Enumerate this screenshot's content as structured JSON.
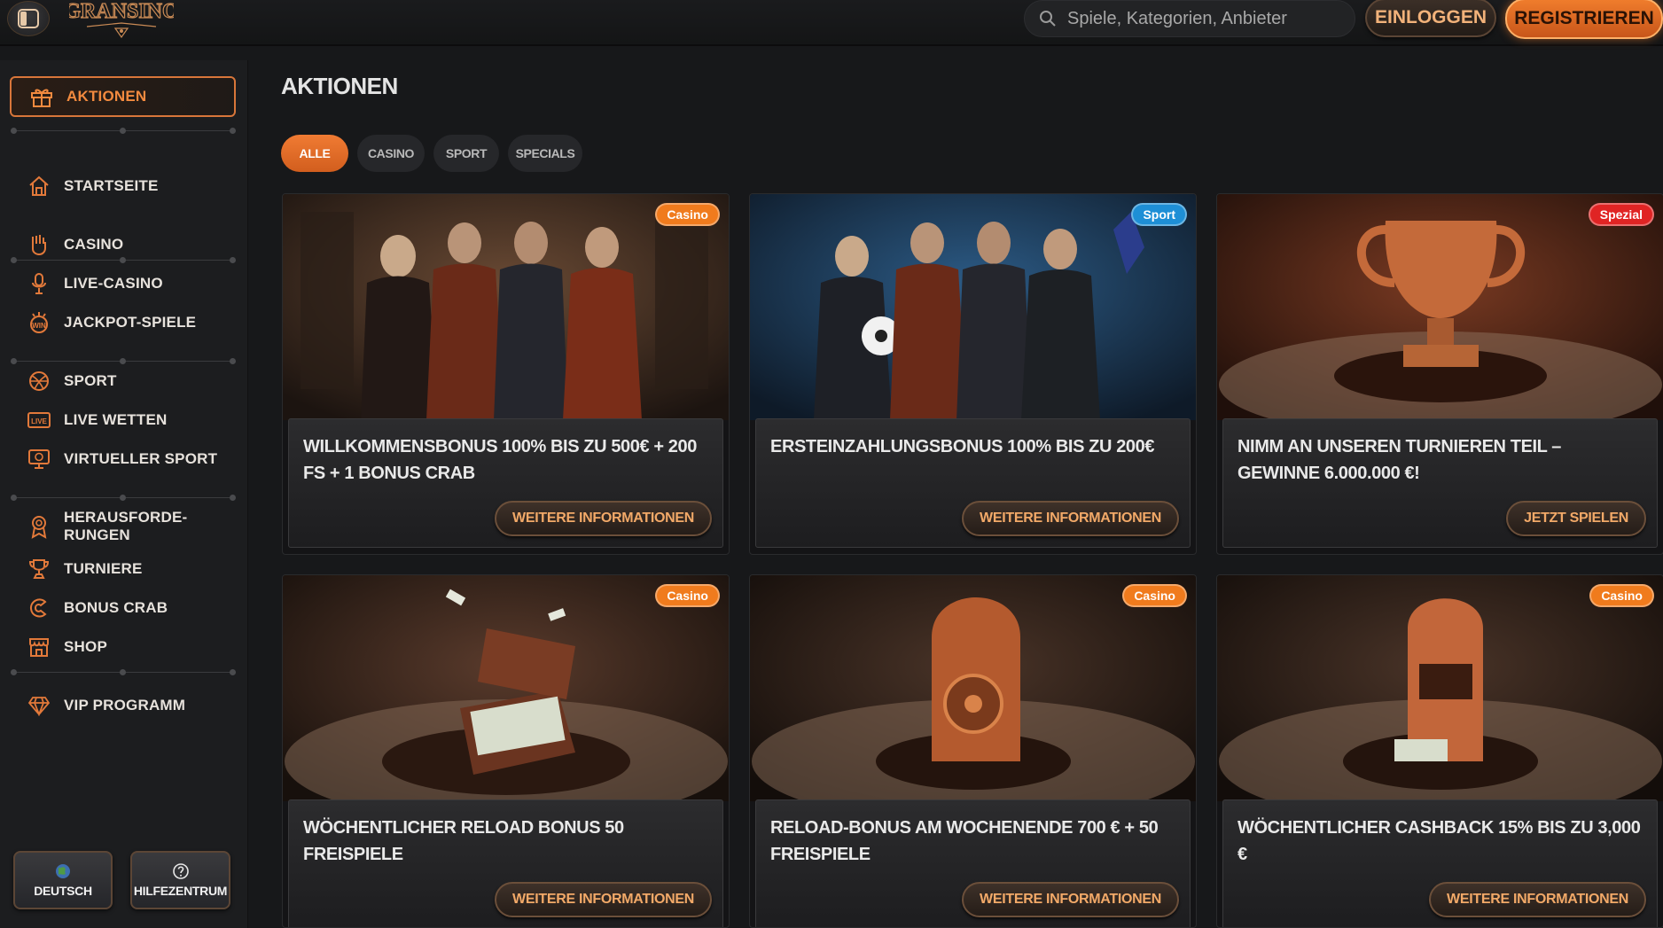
{
  "header": {
    "logo_text": "GRANSINO",
    "search_placeholder": "Spiele, Kategorien, Anbieter",
    "login_label": "EINLOGGEN",
    "register_label": "REGISTRIEREN"
  },
  "sidebar": {
    "active_label": "AKTIONEN",
    "items": [
      {
        "label": "STARTSEITE",
        "icon": "home-icon"
      },
      {
        "label": "CASINO",
        "icon": "casino-hand-icon"
      },
      {
        "label": "LIVE-CASINO",
        "icon": "microphone-icon"
      },
      {
        "label": "JACKPOT-SPIELE",
        "icon": "jackpot-win-icon"
      },
      {
        "label": "SPORT",
        "icon": "ball-icon"
      },
      {
        "label": "LIVE WETTEN",
        "icon": "live-icon"
      },
      {
        "label": "VIRTUELLER SPORT",
        "icon": "virtual-screen-icon"
      },
      {
        "label": "HERAUSFORDE-",
        "label2": "RUNGEN",
        "icon": "medal-icon"
      },
      {
        "label": "TURNIERE",
        "icon": "trophy-icon"
      },
      {
        "label": "BONUS CRAB",
        "icon": "crab-claw-icon"
      },
      {
        "label": "SHOP",
        "icon": "shop-icon"
      },
      {
        "label": "VIP PROGRAMM",
        "icon": "diamond-icon"
      }
    ],
    "language_label": "DEUTSCH",
    "help_label": "HILFEZENTRUM"
  },
  "main": {
    "title": "AKTIONEN",
    "filters": [
      "ALLE",
      "CASINO",
      "SPORT",
      "SPECIALS"
    ],
    "active_filter": "ALLE",
    "cards": [
      {
        "badge": "Casino",
        "title": "WILLKOMMENSBONUS 100% BIS ZU 500€ + 200 FS + 1 BONUS CRAB",
        "button": "WEITERE INFORMATIONEN"
      },
      {
        "badge": "Sport",
        "title": "ERSTEINZAHLUNGSBONUS 100% BIS ZU 200€",
        "button": "WEITERE INFORMATIONEN"
      },
      {
        "badge": "Spezial",
        "title": "NIMM AN UNSEREN TURNIEREN TEIL – GEWINNE 6.000.000 €!",
        "button": "JETZT SPIELEN"
      },
      {
        "badge": "Casino",
        "title": "WÖCHENTLICHER RELOAD BONUS 50 FREISPIELE",
        "button": "WEITERE INFORMATIONEN"
      },
      {
        "badge": "Casino",
        "title": "RELOAD-BONUS AM WOCHENENDE 700 € + 50 FREISPIELE",
        "button": "WEITERE INFORMATIONEN"
      },
      {
        "badge": "Casino",
        "title": "WÖCHENTLICHER CASHBACK 15% BIS ZU 3,000 €",
        "button": "WEITERE INFORMATIONEN"
      }
    ]
  },
  "colors": {
    "accent": "#f07b33",
    "badge_casino": "#f07b1d",
    "badge_sport": "#1e8fd6",
    "badge_spezial": "#e02424",
    "background": "#17181a"
  }
}
